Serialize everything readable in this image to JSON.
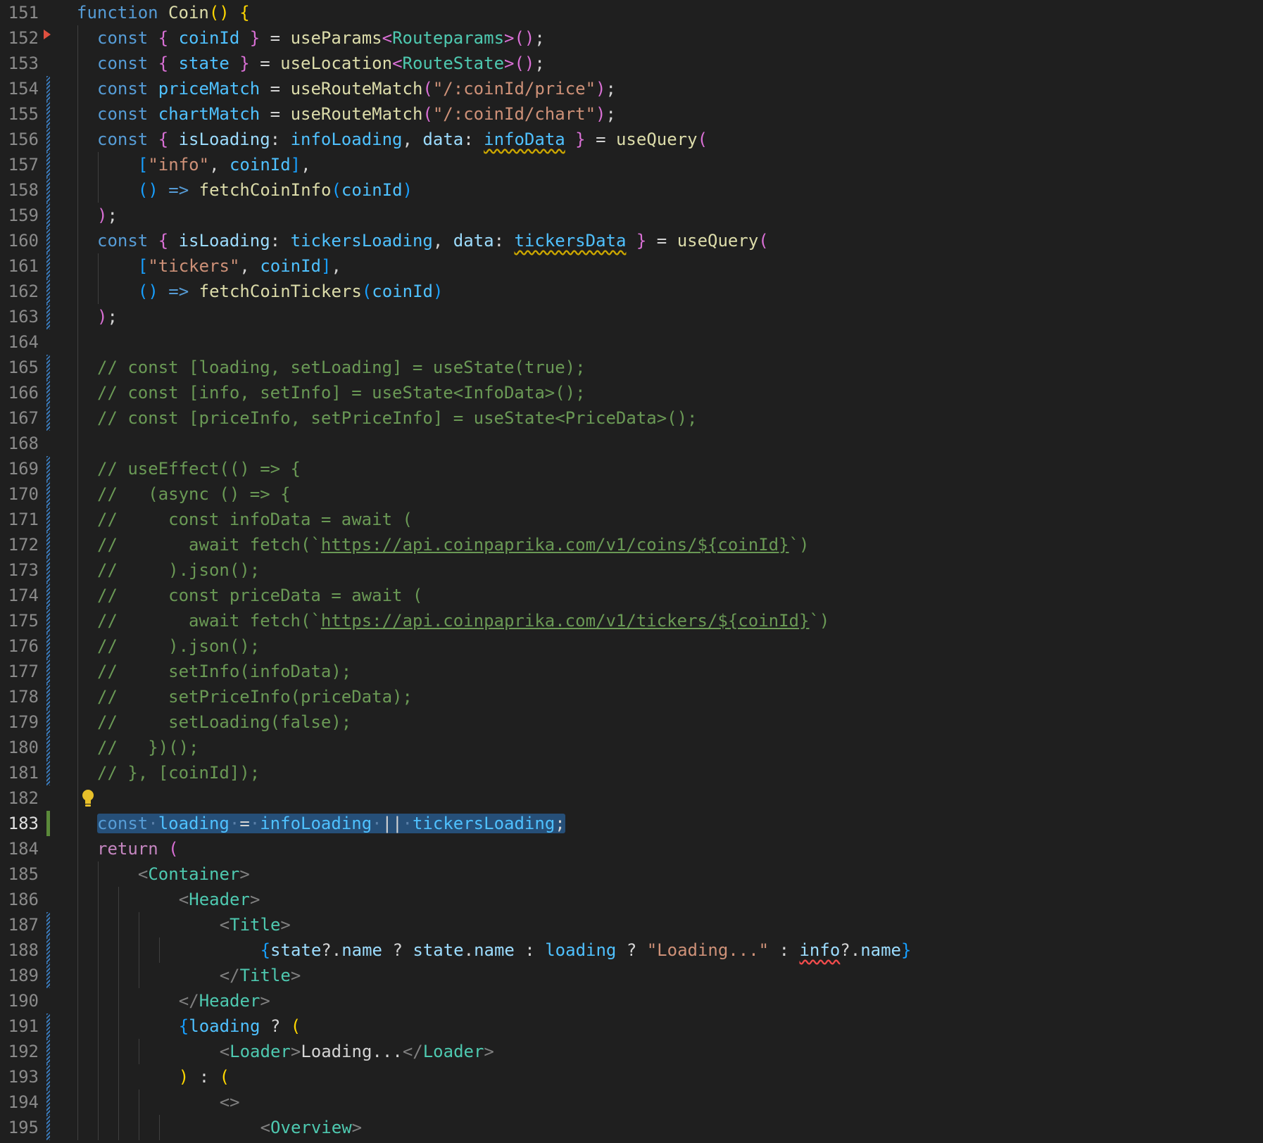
{
  "editor": {
    "language": "TypeScript React",
    "active_line": 183,
    "lines": [
      {
        "num": "151",
        "tokens": [
          [
            "kw",
            "function "
          ],
          [
            "fn",
            "Coin"
          ],
          [
            "p1",
            "()"
          ],
          [
            "text",
            " "
          ],
          [
            "p1",
            "{"
          ]
        ]
      },
      {
        "num": "152",
        "tokens": [
          [
            "kw",
            "const "
          ],
          [
            "p2",
            "{ "
          ],
          [
            "const",
            "coinId"
          ],
          [
            "p2",
            " }"
          ],
          [
            "text",
            " = "
          ],
          [
            "fn",
            "useParams"
          ],
          [
            "p2",
            "<"
          ],
          [
            "type",
            "Routeparams"
          ],
          [
            "p2",
            ">()"
          ],
          [
            "text",
            ";"
          ]
        ]
      },
      {
        "num": "153",
        "tokens": [
          [
            "kw",
            "const "
          ],
          [
            "p2",
            "{ "
          ],
          [
            "const",
            "state"
          ],
          [
            "p2",
            " }"
          ],
          [
            "text",
            " = "
          ],
          [
            "fn",
            "useLocation"
          ],
          [
            "p2",
            "<"
          ],
          [
            "type",
            "RouteState"
          ],
          [
            "p2",
            ">()"
          ],
          [
            "text",
            ";"
          ]
        ]
      },
      {
        "num": "154",
        "tokens": [
          [
            "kw",
            "const "
          ],
          [
            "const",
            "priceMatch"
          ],
          [
            "text",
            " = "
          ],
          [
            "fn",
            "useRouteMatch"
          ],
          [
            "p2",
            "("
          ],
          [
            "str",
            "\"/:coinId/price\""
          ],
          [
            "p2",
            ")"
          ],
          [
            "text",
            ";"
          ]
        ]
      },
      {
        "num": "155",
        "tokens": [
          [
            "kw",
            "const "
          ],
          [
            "const",
            "chartMatch"
          ],
          [
            "text",
            " = "
          ],
          [
            "fn",
            "useRouteMatch"
          ],
          [
            "p2",
            "("
          ],
          [
            "str",
            "\"/:coinId/chart\""
          ],
          [
            "p2",
            ")"
          ],
          [
            "text",
            ";"
          ]
        ]
      },
      {
        "num": "156",
        "tokens": [
          [
            "kw",
            "const "
          ],
          [
            "p2",
            "{ "
          ],
          [
            "var",
            "isLoading"
          ],
          [
            "text",
            ": "
          ],
          [
            "const",
            "infoLoading"
          ],
          [
            "text",
            ", "
          ],
          [
            "var",
            "data"
          ],
          [
            "text",
            ": "
          ],
          [
            "const-warn",
            "infoData"
          ],
          [
            "p2",
            " }"
          ],
          [
            "text",
            " = "
          ],
          [
            "fn",
            "useQuery"
          ],
          [
            "p2",
            "("
          ]
        ]
      },
      {
        "num": "157",
        "tokens": [
          [
            "text",
            "  "
          ],
          [
            "p3",
            "["
          ],
          [
            "str",
            "\"info\""
          ],
          [
            "text",
            ", "
          ],
          [
            "const",
            "coinId"
          ],
          [
            "p3",
            "]"
          ],
          [
            "text",
            ","
          ]
        ]
      },
      {
        "num": "158",
        "tokens": [
          [
            "text",
            "  "
          ],
          [
            "p3",
            "()"
          ],
          [
            "kw",
            " =>"
          ],
          [
            "text",
            " "
          ],
          [
            "fn",
            "fetchCoinInfo"
          ],
          [
            "p3",
            "("
          ],
          [
            "const",
            "coinId"
          ],
          [
            "p3",
            ")"
          ]
        ]
      },
      {
        "num": "159",
        "tokens": [
          [
            "p2",
            ")"
          ],
          [
            "text",
            ";"
          ]
        ]
      },
      {
        "num": "160",
        "tokens": [
          [
            "kw",
            "const "
          ],
          [
            "p2",
            "{ "
          ],
          [
            "var",
            "isLoading"
          ],
          [
            "text",
            ": "
          ],
          [
            "const",
            "tickersLoading"
          ],
          [
            "text",
            ", "
          ],
          [
            "var",
            "data"
          ],
          [
            "text",
            ": "
          ],
          [
            "const-warn",
            "tickersData"
          ],
          [
            "p2",
            " }"
          ],
          [
            "text",
            " = "
          ],
          [
            "fn",
            "useQuery"
          ],
          [
            "p2",
            "("
          ]
        ]
      },
      {
        "num": "161",
        "tokens": [
          [
            "text",
            "  "
          ],
          [
            "p3",
            "["
          ],
          [
            "str",
            "\"tickers\""
          ],
          [
            "text",
            ", "
          ],
          [
            "const",
            "coinId"
          ],
          [
            "p3",
            "]"
          ],
          [
            "text",
            ","
          ]
        ]
      },
      {
        "num": "162",
        "tokens": [
          [
            "text",
            "  "
          ],
          [
            "p3",
            "()"
          ],
          [
            "kw",
            " =>"
          ],
          [
            "text",
            " "
          ],
          [
            "fn",
            "fetchCoinTickers"
          ],
          [
            "p3",
            "("
          ],
          [
            "const",
            "coinId"
          ],
          [
            "p3",
            ")"
          ]
        ]
      },
      {
        "num": "163",
        "tokens": [
          [
            "p2",
            ")"
          ],
          [
            "text",
            ";"
          ]
        ]
      },
      {
        "num": "164",
        "tokens": []
      },
      {
        "num": "165",
        "tokens": [
          [
            "cmt",
            "// const [loading, setLoading] = useState(true);"
          ]
        ]
      },
      {
        "num": "166",
        "tokens": [
          [
            "cmt",
            "// const [info, setInfo] = useState<InfoData>();"
          ]
        ]
      },
      {
        "num": "167",
        "tokens": [
          [
            "cmt",
            "// const [priceInfo, setPriceInfo] = useState<PriceData>();"
          ]
        ]
      },
      {
        "num": "168",
        "tokens": []
      },
      {
        "num": "169",
        "tokens": [
          [
            "cmt",
            "// useEffect(() => {"
          ]
        ]
      },
      {
        "num": "170",
        "tokens": [
          [
            "cmt",
            "//   (async () => {"
          ]
        ]
      },
      {
        "num": "171",
        "tokens": [
          [
            "cmt",
            "//     const infoData = await ("
          ]
        ]
      },
      {
        "num": "172",
        "tokens": [
          [
            "cmt",
            "//       await fetch(`"
          ],
          [
            "link",
            "https://api.coinpaprika.com/v1/coins/${coinId}"
          ],
          [
            "cmt",
            "`)"
          ]
        ]
      },
      {
        "num": "173",
        "tokens": [
          [
            "cmt",
            "//     ).json();"
          ]
        ]
      },
      {
        "num": "174",
        "tokens": [
          [
            "cmt",
            "//     const priceData = await ("
          ]
        ]
      },
      {
        "num": "175",
        "tokens": [
          [
            "cmt",
            "//       await fetch(`"
          ],
          [
            "link",
            "https://api.coinpaprika.com/v1/tickers/${coinId}"
          ],
          [
            "cmt",
            "`)"
          ]
        ]
      },
      {
        "num": "176",
        "tokens": [
          [
            "cmt",
            "//     ).json();"
          ]
        ]
      },
      {
        "num": "177",
        "tokens": [
          [
            "cmt",
            "//     setInfo(infoData);"
          ]
        ]
      },
      {
        "num": "178",
        "tokens": [
          [
            "cmt",
            "//     setPriceInfo(priceData);"
          ]
        ]
      },
      {
        "num": "179",
        "tokens": [
          [
            "cmt",
            "//     setLoading(false);"
          ]
        ]
      },
      {
        "num": "180",
        "tokens": [
          [
            "cmt",
            "//   })();"
          ]
        ]
      },
      {
        "num": "181",
        "tokens": [
          [
            "cmt",
            "// }, [coinId]);"
          ]
        ]
      },
      {
        "num": "182",
        "tokens": []
      },
      {
        "num": "183",
        "tokens": [
          [
            "kw",
            "const"
          ],
          [
            "ws",
            "·"
          ],
          [
            "const",
            "loading"
          ],
          [
            "ws",
            "·"
          ],
          [
            "text",
            "="
          ],
          [
            "ws",
            "·"
          ],
          [
            "const",
            "infoLoading"
          ],
          [
            "ws",
            "·"
          ],
          [
            "text",
            "||"
          ],
          [
            "ws",
            "·"
          ],
          [
            "const",
            "tickersLoading"
          ],
          [
            "text",
            ";"
          ]
        ]
      },
      {
        "num": "184",
        "tokens": [
          [
            "ctl",
            "return "
          ],
          [
            "p2",
            "("
          ]
        ]
      },
      {
        "num": "185",
        "tokens": [
          [
            "text",
            "  "
          ],
          [
            "tagp",
            "<"
          ],
          [
            "tag",
            "Container"
          ],
          [
            "tagp",
            ">"
          ]
        ]
      },
      {
        "num": "186",
        "tokens": [
          [
            "text",
            "    "
          ],
          [
            "tagp",
            "<"
          ],
          [
            "tag",
            "Header"
          ],
          [
            "tagp",
            ">"
          ]
        ]
      },
      {
        "num": "187",
        "tokens": [
          [
            "text",
            "      "
          ],
          [
            "tagp",
            "<"
          ],
          [
            "tag",
            "Title"
          ],
          [
            "tagp",
            ">"
          ]
        ]
      },
      {
        "num": "188",
        "tokens": [
          [
            "text",
            "        "
          ],
          [
            "p3",
            "{"
          ],
          [
            "var",
            "state"
          ],
          [
            "text",
            "?."
          ],
          [
            "var",
            "name"
          ],
          [
            "text",
            " ? "
          ],
          [
            "var",
            "state"
          ],
          [
            "text",
            "."
          ],
          [
            "var",
            "name"
          ],
          [
            "text",
            " : "
          ],
          [
            "const",
            "loading"
          ],
          [
            "text",
            " ? "
          ],
          [
            "str",
            "\"Loading...\""
          ],
          [
            "text",
            " : "
          ],
          [
            "var-err",
            "info"
          ],
          [
            "text",
            "?."
          ],
          [
            "var",
            "name"
          ],
          [
            "p3",
            "}"
          ]
        ]
      },
      {
        "num": "189",
        "tokens": [
          [
            "text",
            "      "
          ],
          [
            "tagp",
            "</"
          ],
          [
            "tag",
            "Title"
          ],
          [
            "tagp",
            ">"
          ]
        ]
      },
      {
        "num": "190",
        "tokens": [
          [
            "text",
            "    "
          ],
          [
            "tagp",
            "</"
          ],
          [
            "tag",
            "Header"
          ],
          [
            "tagp",
            ">"
          ]
        ]
      },
      {
        "num": "191",
        "tokens": [
          [
            "text",
            "    "
          ],
          [
            "p3",
            "{"
          ],
          [
            "const",
            "loading"
          ],
          [
            "text",
            " ? "
          ],
          [
            "p1",
            "("
          ]
        ]
      },
      {
        "num": "192",
        "tokens": [
          [
            "text",
            "      "
          ],
          [
            "tagp",
            "<"
          ],
          [
            "tag",
            "Loader"
          ],
          [
            "tagp",
            ">"
          ],
          [
            "text",
            "Loading..."
          ],
          [
            "tagp",
            "</"
          ],
          [
            "tag",
            "Loader"
          ],
          [
            "tagp",
            ">"
          ]
        ]
      },
      {
        "num": "193",
        "tokens": [
          [
            "text",
            "    "
          ],
          [
            "p1",
            ")"
          ],
          [
            "text",
            " : "
          ],
          [
            "p1",
            "("
          ]
        ]
      },
      {
        "num": "194",
        "tokens": [
          [
            "text",
            "      "
          ],
          [
            "tagp",
            "<>"
          ]
        ]
      },
      {
        "num": "195",
        "tokens": [
          [
            "text",
            "        "
          ],
          [
            "tagp",
            "<"
          ],
          [
            "tag",
            "Overview"
          ],
          [
            "tagp",
            ">"
          ]
        ]
      }
    ]
  }
}
